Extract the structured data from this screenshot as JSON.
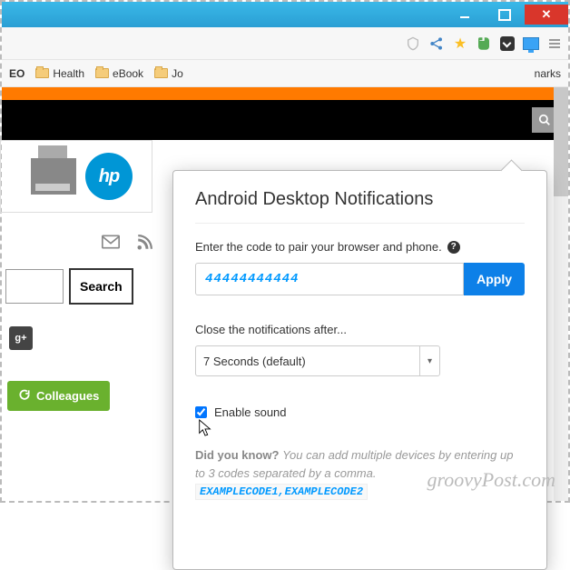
{
  "window": {
    "minimize": "",
    "maximize": "",
    "close": ""
  },
  "bookmarks": {
    "left_trunc": "EO",
    "items": [
      "Health",
      "eBook",
      "Jo"
    ],
    "right_trunc": "narks"
  },
  "sidebar": {
    "hp_label": "hp",
    "search_btn": "Search",
    "gplus": "g+",
    "colleagues": "Colleagues"
  },
  "popup": {
    "title": "Android Desktop Notifications",
    "pair_label": "Enter the code to pair your browser and phone.",
    "code_value": "44444444444",
    "apply": "Apply",
    "close_label": "Close the notifications after...",
    "timeout_value": "7 Seconds (default)",
    "sound_label": "Enable sound",
    "sound_checked": true,
    "dyk_title": "Did you know?",
    "dyk_body": "You can add multiple devices by entering up to 3 codes separated by a comma.",
    "dyk_example": "EXAMPLECODE1,EXAMPLECODE2"
  },
  "watermark": "groovyPost.com"
}
